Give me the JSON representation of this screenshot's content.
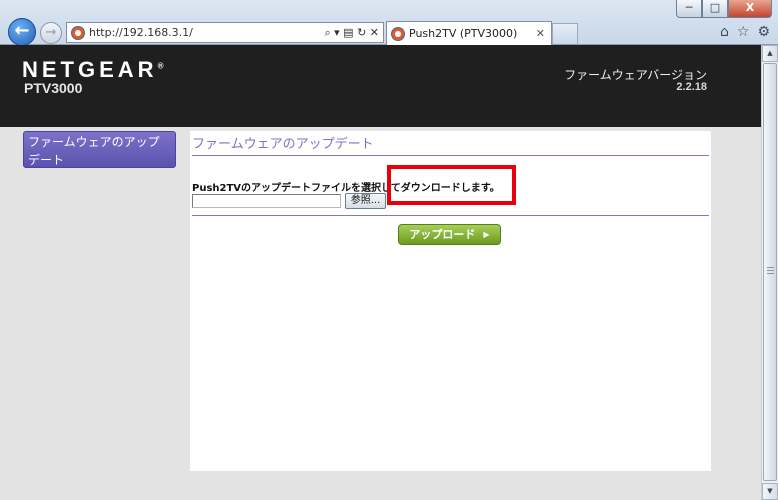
{
  "browser": {
    "window_controls": {
      "minimize": "─",
      "maximize": "□",
      "close": "X"
    },
    "back_glyph": "←",
    "forward_glyph": "→",
    "address": "http://192.168.3.1/",
    "address_tools": "⌕ ▾ ▤ ↻ ✕",
    "tab_title": "Push2TV (PTV3000)",
    "tab_close": "✕",
    "toolbar_icons": [
      "⌂",
      "☆",
      "⚙"
    ]
  },
  "header": {
    "brand": "NETGEAR",
    "brand_mark": "®",
    "model": "PTV3000",
    "firmware_label": "ファームウェアバージョン",
    "firmware_version": "2.2.18"
  },
  "sidebar": {
    "items": [
      {
        "label": "ファームウェアのアップデート"
      }
    ]
  },
  "main": {
    "title": "ファームウェアのアップデート",
    "instruction": "Push2TVのアップデートファイルを選択してダウンロードします。",
    "file_value": "",
    "browse_label": "参照...",
    "upload_label": "アップロード",
    "upload_arrow": "▶"
  },
  "scrollbar": {
    "up": "▲",
    "down": "▼"
  },
  "colors": {
    "header_bg": "#1f1f1f",
    "accent_purple": "#7f76d0",
    "upload_green": "#8ab83c",
    "highlight_red": "#e8000b"
  }
}
